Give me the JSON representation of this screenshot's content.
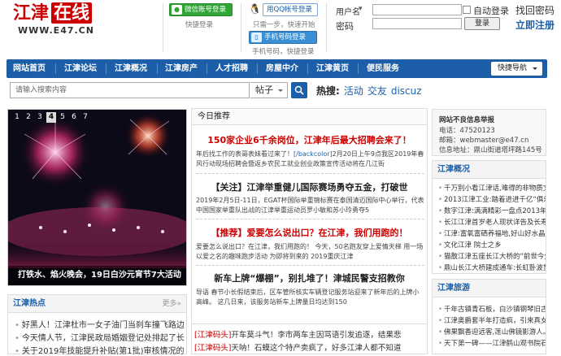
{
  "logo": {
    "name": "江津",
    "tag": "在线",
    "url": "WWW.E47.CN"
  },
  "login": {
    "wechat_btn": "微信账号登录",
    "qq_btn": "用QQ帐号登录",
    "fast_login": "快捷登录",
    "qq_sub": "只需一步，快速开始",
    "phone_btn": "手机号码登录",
    "phone_sub": "手机号码，快捷登录",
    "user_label": "用户名",
    "user_arrow": "▾",
    "pwd_label": "密码",
    "auto_login": "自动登录",
    "find_pwd": "找回密码",
    "login_btn": "登录",
    "register": "立即注册"
  },
  "nav": {
    "items": [
      "网站首页",
      "江津论坛",
      "江津概况",
      "江津房产",
      "人才招聘",
      "房屋中介",
      "江津黄页",
      "便民服务"
    ],
    "quick": "快捷导航"
  },
  "search": {
    "placeholder": "请输入搜索内容",
    "scope": "帖子",
    "hot_label": "热搜:",
    "hot": [
      "活动",
      "交友",
      "discuz"
    ]
  },
  "slider": {
    "pages": [
      "1",
      "2",
      "3",
      "4",
      "5",
      "6",
      "7"
    ],
    "active": "4",
    "caption": "打铁水、焰火晚会，19日白沙元宵节7大活动"
  },
  "hot": {
    "title": "江津热点",
    "more": "更多»",
    "items": [
      "好黑人！江津杜市一女子油门当刹车撞飞路边",
      "今天情人节，江津民政局婚姻登记处排起了长",
      "关于2019年技能提升补贴(第1批)审核情况的"
    ]
  },
  "today": {
    "title": "今日推荐",
    "h1": "150家企业6千余岗位，江津年后最大招聘会来了！",
    "t1a": "年后找工作的表哥表妹看过来了！",
    "t1tag": "[/backcolor]",
    "t1b": "2月20日上午9点我区2019年春风行动现场招聘会暨返乡农民工就业创业政策宣传活动将在几江街",
    "h2": "【关注】江津举重健儿国际赛场勇夺五金，打破世",
    "t2": "2019年2月5日-11日，EGAT杯国际举重锦标赛在泰国清迈国际中心举行，代表中国国家举重队出战的江津举重运动员罗小敏和苏小玲勇夺5",
    "h3": "【推荐】爱要怎么说出口？在江津，我们用跑的！",
    "t3": "爱要怎么说出口？在江津，我们用跑的！ 今天，50名跑友穿上爱情天梯 用一场以爱之名的趣味跑步活动 为即将到来的 2019重庆江津",
    "h4": "新车上牌“爆棚”，别扎堆了！津城民警支招教你",
    "t4": "导语 春节小长假结束后，区车管所核实车辆登记服务站迎来了新年后的上牌小高峰。 这几日来，该服务站新车上牌量日均达到150"
  },
  "bottom": {
    "tag1": "[江津码头]",
    "line1": "开车莫斗气！李市两车主因骂语引发追逐，结果悲",
    "tag2": "[江津码头]",
    "line2": "天呐！石蟆这个特产卖疯了，好多江津人都不知道"
  },
  "right": {
    "notice_title": "网站不良信息举报",
    "tel": "电话：47520123",
    "email": "邮箱：webmaster@e47.cn",
    "addr": "信息地址：鼎山街道塔坪路145号",
    "gk_title": "江津概况",
    "gk": [
      "千万别小看江津话,难得的非物质文",
      "2013江津工业:踏着进进千亿“俱乐",
      "数字江津:满满精彩一盘点2013年全",
      "长江江津首岁老人现状详告及长寿机理",
      "江津:富氧富硒养福地,好山好水晶所",
      "文化江津 院士之乡",
      "猫散江津五座长江大桥的“前世今生”",
      "鼎山长江大桥建成通车:长虹卧波贯"
    ],
    "ly_title": "江津旅游",
    "ly": [
      "千年古镇青石板，白沙镇钢琴旧古时",
      "江津奥爵套半年打造疯，引来真女",
      "佛果飘香迎远客,莲山佛镜影游人。",
      "天下第一碑——江津鹤山观书院石刻"
    ]
  },
  "colors": {
    "brand": "#c00000",
    "nav": "#1c5fa8"
  }
}
